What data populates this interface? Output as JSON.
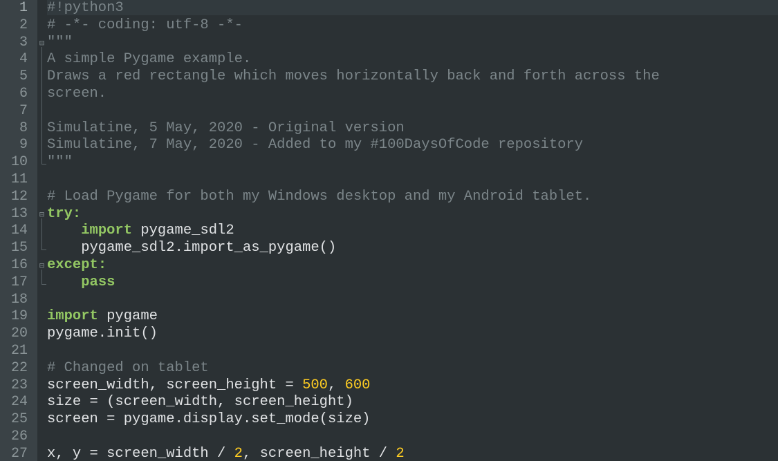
{
  "editor": {
    "language": "Python",
    "lines": [
      {
        "n": "1",
        "tokens": [
          {
            "t": "#!python3",
            "c": "comment"
          }
        ]
      },
      {
        "n": "2",
        "tokens": [
          {
            "t": "# -*- coding: utf-8 -*-",
            "c": "comment"
          }
        ]
      },
      {
        "n": "3",
        "tokens": [
          {
            "t": "\"\"\"",
            "c": "comment"
          }
        ]
      },
      {
        "n": "4",
        "tokens": [
          {
            "t": "A simple Pygame example.",
            "c": "comment"
          }
        ]
      },
      {
        "n": "5",
        "tokens": [
          {
            "t": "Draws a red rectangle which moves horizontally back and forth across the",
            "c": "comment"
          }
        ]
      },
      {
        "n": "6",
        "tokens": [
          {
            "t": "screen.",
            "c": "comment"
          }
        ]
      },
      {
        "n": "7",
        "tokens": []
      },
      {
        "n": "8",
        "tokens": [
          {
            "t": "Simulatine, 5 May, 2020 - Original version",
            "c": "comment"
          }
        ]
      },
      {
        "n": "9",
        "tokens": [
          {
            "t": "Simulatine, 7 May, 2020 - Added to my #100DaysOfCode repository",
            "c": "comment"
          }
        ]
      },
      {
        "n": "10",
        "tokens": [
          {
            "t": "\"\"\"",
            "c": "comment"
          }
        ]
      },
      {
        "n": "11",
        "tokens": []
      },
      {
        "n": "12",
        "tokens": [
          {
            "t": "# Load Pygame for both my Windows desktop and my Android tablet.",
            "c": "comment"
          }
        ]
      },
      {
        "n": "13",
        "tokens": [
          {
            "t": "try",
            "c": "kw"
          },
          {
            "t": ":",
            "c": "kw"
          }
        ]
      },
      {
        "n": "14",
        "tokens": [
          {
            "t": "    ",
            "c": "plain"
          },
          {
            "t": "import",
            "c": "kw"
          },
          {
            "t": " pygame_sdl2",
            "c": "plain"
          }
        ]
      },
      {
        "n": "15",
        "tokens": [
          {
            "t": "    pygame_sdl2.import_as_pygame()",
            "c": "plain"
          }
        ]
      },
      {
        "n": "16",
        "tokens": [
          {
            "t": "except",
            "c": "kw"
          },
          {
            "t": ":",
            "c": "kw"
          }
        ]
      },
      {
        "n": "17",
        "tokens": [
          {
            "t": "    ",
            "c": "plain"
          },
          {
            "t": "pass",
            "c": "kw"
          }
        ]
      },
      {
        "n": "18",
        "tokens": []
      },
      {
        "n": "19",
        "tokens": [
          {
            "t": "import",
            "c": "kw"
          },
          {
            "t": " pygame",
            "c": "plain"
          }
        ]
      },
      {
        "n": "20",
        "tokens": [
          {
            "t": "pygame.init()",
            "c": "plain"
          }
        ]
      },
      {
        "n": "21",
        "tokens": []
      },
      {
        "n": "22",
        "tokens": [
          {
            "t": "# Changed on tablet",
            "c": "comment"
          }
        ]
      },
      {
        "n": "23",
        "tokens": [
          {
            "t": "screen_width, screen_height = ",
            "c": "plain"
          },
          {
            "t": "500",
            "c": "num"
          },
          {
            "t": ", ",
            "c": "plain"
          },
          {
            "t": "600",
            "c": "num"
          }
        ]
      },
      {
        "n": "24",
        "tokens": [
          {
            "t": "size = (screen_width, screen_height)",
            "c": "plain"
          }
        ]
      },
      {
        "n": "25",
        "tokens": [
          {
            "t": "screen = pygame.display.set_mode(size)",
            "c": "plain"
          }
        ]
      },
      {
        "n": "26",
        "tokens": []
      },
      {
        "n": "27",
        "tokens": [
          {
            "t": "x, y = screen_width / ",
            "c": "plain"
          },
          {
            "t": "2",
            "c": "num"
          },
          {
            "t": ", screen_height / ",
            "c": "plain"
          },
          {
            "t": "2",
            "c": "num"
          }
        ]
      }
    ],
    "fold_markers": [
      {
        "line": 3,
        "symbol": "⊟"
      },
      {
        "line": 13,
        "symbol": "⊟"
      },
      {
        "line": 16,
        "symbol": "⊟"
      }
    ],
    "current_line": 1
  },
  "colors": {
    "background": "#2b3134",
    "gutter": "#3a4246",
    "comment": "#7b8589",
    "keyword": "#93c763",
    "plain": "#e0e2e4",
    "number": "#ffcd22"
  }
}
